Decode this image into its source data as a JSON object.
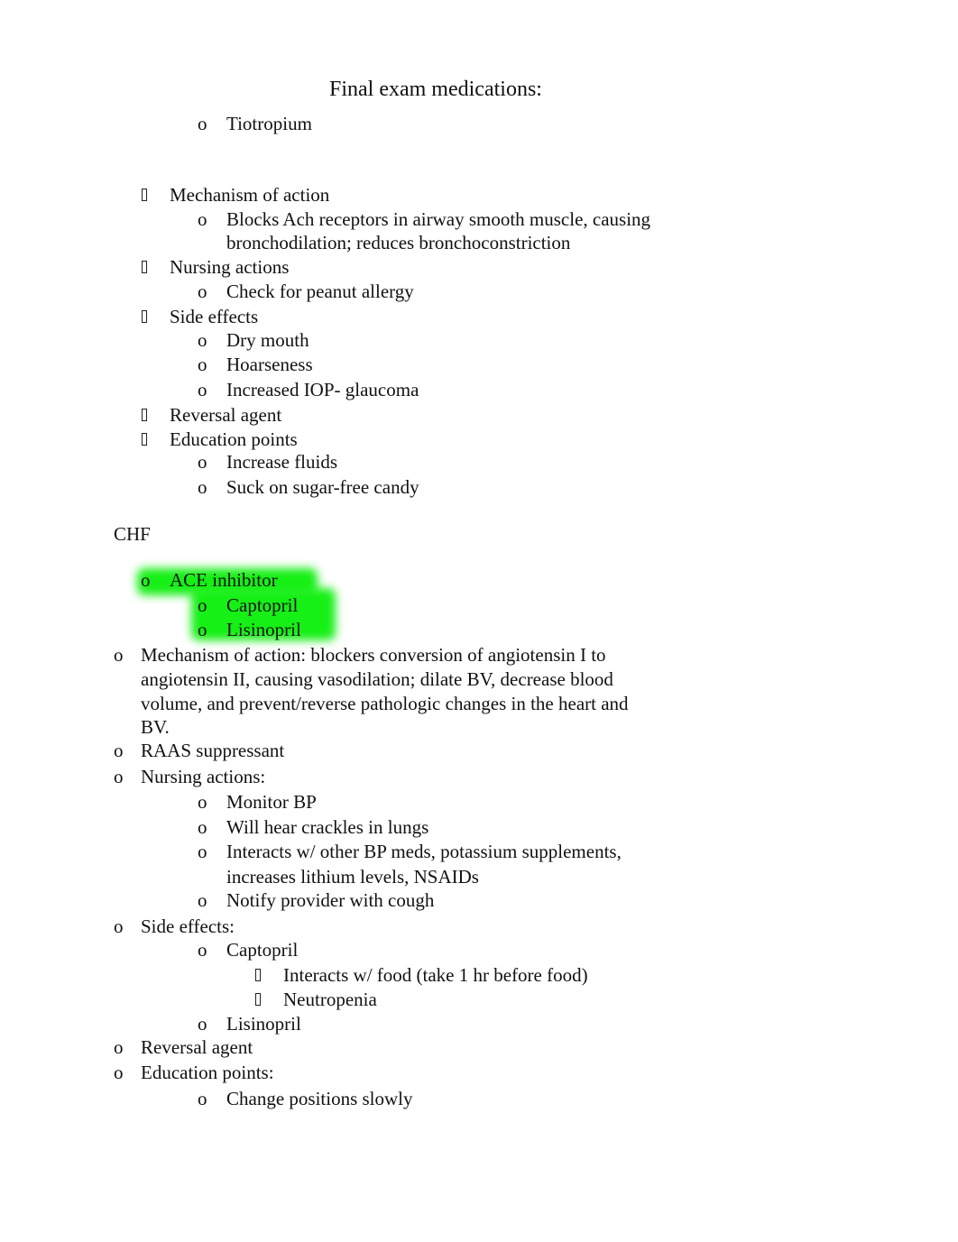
{
  "document": {
    "title": "Final exam medications:",
    "bullets": {
      "circle": "o",
      "square": "square-bullet"
    },
    "highlight_color": "#16F016",
    "section1": {
      "drug": "Tiotropium",
      "mechanism_label": "Mechanism of action",
      "mechanism_line1": "Blocks Ach receptors in airway smooth muscle, causing",
      "mechanism_line2": "bronchodilation; reduces bronchoconstriction",
      "nursing_label": "Nursing actions",
      "nursing_items": [
        "Check for peanut allergy"
      ],
      "side_effects_label": "Side effects",
      "side_effects": [
        "Dry mouth",
        "Hoarseness",
        "Increased IOP- glaucoma"
      ],
      "reversal_label": "Reversal agent",
      "education_label": "Education points",
      "education_items": [
        "Increase fluids",
        "Suck on sugar-free candy"
      ]
    },
    "section2": {
      "heading": "CHF",
      "class_label": "ACE inhibitor",
      "drugs": [
        "Captopril",
        "Lisinopril"
      ],
      "mechanism_lines": [
        "Mechanism of action: blockers conversion of angiotensin I to",
        "angiotensin II, causing vasodilation; dilate BV, decrease blood",
        "volume, and prevent/reverse pathologic changes in the heart and",
        "BV."
      ],
      "raas": "RAAS suppressant",
      "nursing_label": "Nursing actions:",
      "nursing_items": [
        "Monitor BP",
        "Will hear crackles in lungs",
        "Interacts w/ other BP meds, potassium supplements,",
        "increases lithium levels, NSAIDs",
        "Notify provider with cough"
      ],
      "side_effects_label": "Side effects:",
      "captopril_label": "Captopril",
      "captopril_effects": [
        "Interacts w/ food (take 1 hr before food)",
        "Neutropenia"
      ],
      "lisinopril_label": "Lisinopril",
      "reversal_label": "Reversal agent",
      "education_label": "Education points:",
      "education_items": [
        "Change positions slowly"
      ]
    }
  }
}
